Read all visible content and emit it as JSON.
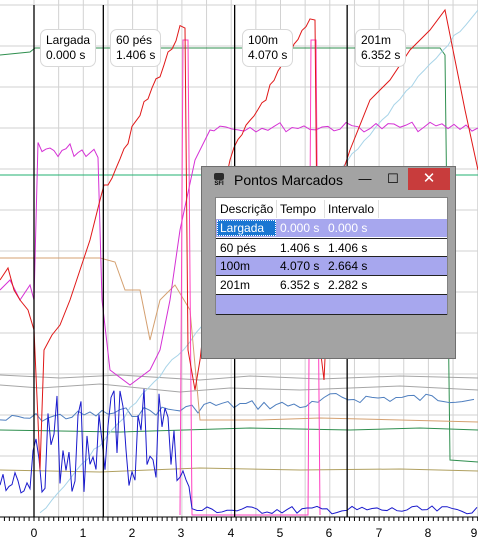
{
  "markers": [
    {
      "name": "Largada",
      "time": "0.000 s",
      "t": 0.0
    },
    {
      "name": "60 pés",
      "time": "1.406 s",
      "t": 1.406
    },
    {
      "name": "100m",
      "time": "4.070 s",
      "t": 4.07
    },
    {
      "name": "201m",
      "time": "6.352 s",
      "t": 6.352
    }
  ],
  "axis": {
    "ticks": [
      "0",
      "1",
      "2",
      "3",
      "4",
      "5",
      "6",
      "7",
      "8",
      "9"
    ]
  },
  "dialog": {
    "title": "Pontos Marcados",
    "icon_label": "SFI",
    "min_symbol": "—",
    "max_symbol": "☐",
    "close_symbol": "✕",
    "headers": [
      "Descrição",
      "Tempo",
      "Intervalo"
    ],
    "rows": [
      [
        "Largada",
        "0.000 s",
        "0.000 s"
      ],
      [
        "60 pés",
        "1.406 s",
        "1.406 s"
      ],
      [
        "100m",
        "4.070 s",
        "2.664 s"
      ],
      [
        "201m",
        "6.352 s",
        "2.282 s"
      ]
    ]
  },
  "colors": {
    "grid": "#d2d2d2",
    "red": "#e01818",
    "magenta": "#d531d5",
    "pink": "#ff3fc0",
    "blue": "#1a1acc",
    "steel": "#4f7fbf",
    "lightblue": "#a8d4e8",
    "green": "#2f8f4f",
    "teal": "#22b070",
    "tan": "#d4a070",
    "gray": "#a6a6a6",
    "olive": "#b0a060"
  }
}
